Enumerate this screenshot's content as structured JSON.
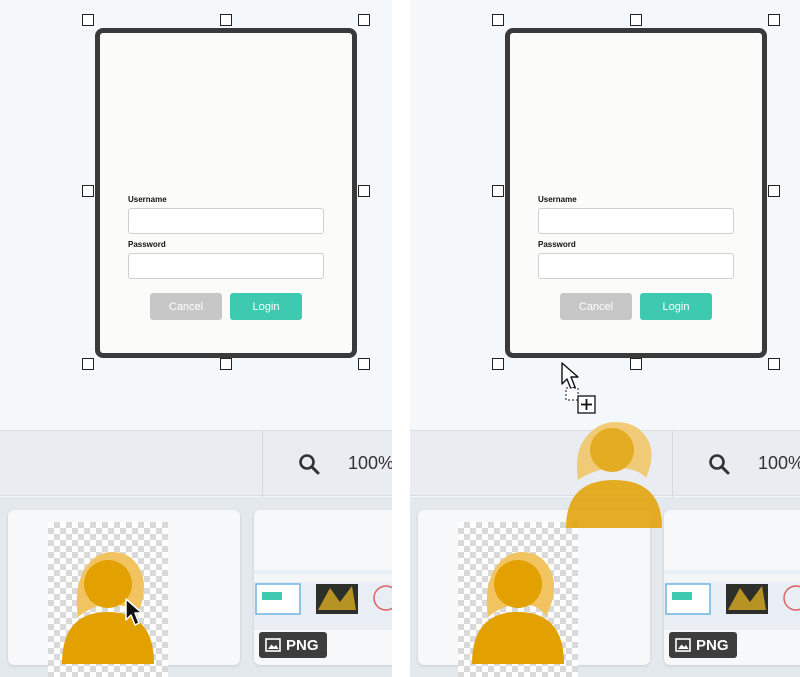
{
  "mockup": {
    "username_label": "Username",
    "password_label": "Password",
    "cancel_label": "Cancel",
    "login_label": "Login"
  },
  "toolbar": {
    "zoom": "100%"
  },
  "tray": {
    "badge_label": "PNG"
  },
  "icons": [
    "search-icon",
    "image-icon",
    "arrow-cursor-icon",
    "drag-copy-cursor-icon",
    "avatar-icon"
  ],
  "colors": {
    "login": "#3dcab0",
    "cancel": "#c7c7c7",
    "avatar_dark": "#e2a100",
    "avatar_light": "#f2c461",
    "frame": "#3a3a3a"
  }
}
